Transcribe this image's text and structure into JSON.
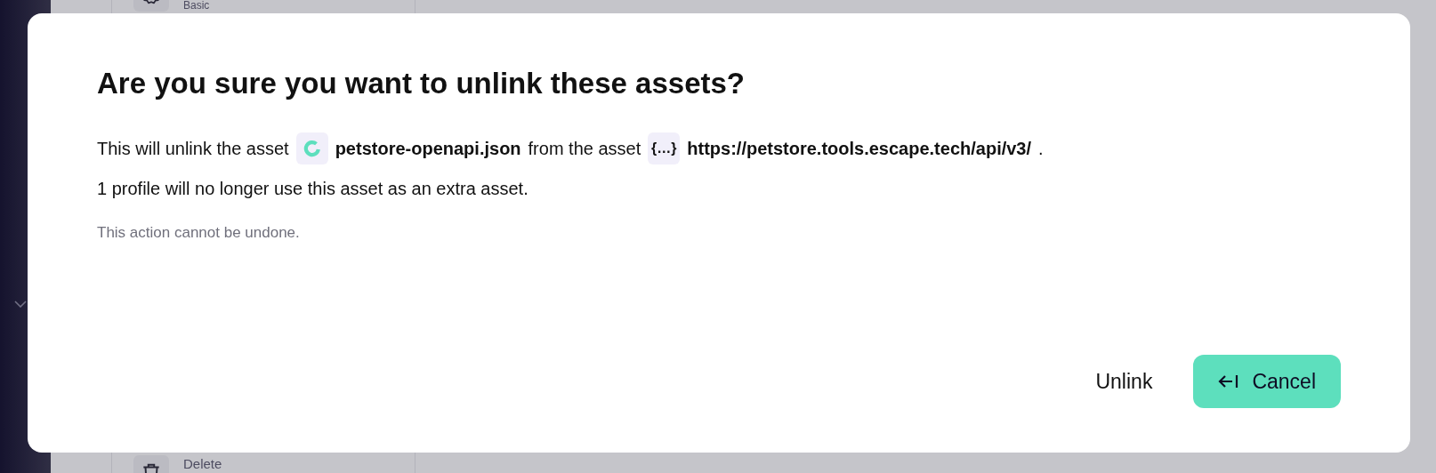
{
  "background": {
    "menu_items": [
      {
        "label": "Basic",
        "kind": "gear"
      },
      {
        "label": "Delete",
        "kind": "trash"
      }
    ]
  },
  "dialog": {
    "title": "Are you sure you want to unlink these assets?",
    "message": {
      "before": "This will unlink the asset",
      "source_asset": {
        "kind": "openapi",
        "name": "petstore-openapi.json"
      },
      "middle": "from the asset",
      "target_asset": {
        "kind": "json",
        "glyph": "{…}",
        "name": "https://petstore.tools.escape.tech/api/v3/"
      },
      "after": "."
    },
    "detail": "1 profile will no longer use this asset as an extra asset.",
    "warning": "This action cannot be undone.",
    "buttons": [
      {
        "label": "Unlink",
        "kind": "text"
      },
      {
        "label": "Cancel",
        "kind": "primary"
      }
    ]
  }
}
